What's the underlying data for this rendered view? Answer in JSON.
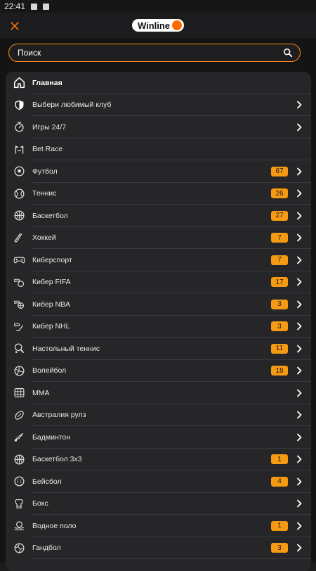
{
  "status": {
    "time": "22:41"
  },
  "header": {
    "logo_text": "Winline",
    "close_icon": "close-icon"
  },
  "search": {
    "placeholder": "Поиск",
    "icon": "search-icon"
  },
  "colors": {
    "accent": "#ff7a00",
    "badge": "#f59a12",
    "panel": "#262628",
    "background": "#141414"
  },
  "menu": {
    "items": [
      {
        "label": "Главная",
        "icon": "home-icon",
        "badge": null,
        "chevron": false
      },
      {
        "label": "Выбери любимый клуб",
        "icon": "shield-icon",
        "badge": null,
        "chevron": true
      },
      {
        "label": "Игры 24/7",
        "icon": "stopwatch-icon",
        "badge": null,
        "chevron": true
      },
      {
        "label": "Bet Race",
        "icon": "race-flags-icon",
        "badge": null,
        "chevron": false
      },
      {
        "label": "Футбол",
        "icon": "soccer-ball-icon",
        "badge": "67",
        "chevron": true
      },
      {
        "label": "Теннис",
        "icon": "tennis-ball-icon",
        "badge": "26",
        "chevron": true
      },
      {
        "label": "Баскетбол",
        "icon": "basketball-icon",
        "badge": "27",
        "chevron": true
      },
      {
        "label": "Хоккей",
        "icon": "hockey-stick-icon",
        "badge": "7",
        "chevron": true
      },
      {
        "label": "Киберспорт",
        "icon": "gamepad-icon",
        "badge": "7",
        "chevron": true
      },
      {
        "label": "Кибер FIFA",
        "icon": "cyber-fifa-icon",
        "badge": "17",
        "chevron": true
      },
      {
        "label": "Кибер NBA",
        "icon": "cyber-nba-icon",
        "badge": "3",
        "chevron": true
      },
      {
        "label": "Кибер NHL",
        "icon": "cyber-nhl-icon",
        "badge": "3",
        "chevron": true
      },
      {
        "label": "Настольный теннис",
        "icon": "table-tennis-icon",
        "badge": "11",
        "chevron": true
      },
      {
        "label": "Волейбол",
        "icon": "volleyball-icon",
        "badge": "18",
        "chevron": true
      },
      {
        "label": "MMA",
        "icon": "mma-cage-icon",
        "badge": null,
        "chevron": true
      },
      {
        "label": "Австралия рулз",
        "icon": "rugby-ball-icon",
        "badge": null,
        "chevron": true
      },
      {
        "label": "Бадминтон",
        "icon": "shuttlecock-icon",
        "badge": null,
        "chevron": true
      },
      {
        "label": "Баскетбол 3х3",
        "icon": "basketball-3x3-icon",
        "badge": "1",
        "chevron": true
      },
      {
        "label": "Бейсбол",
        "icon": "baseball-icon",
        "badge": "4",
        "chevron": true
      },
      {
        "label": "Бокс",
        "icon": "boxing-glove-icon",
        "badge": null,
        "chevron": true
      },
      {
        "label": "Водное поло",
        "icon": "water-polo-icon",
        "badge": "1",
        "chevron": true
      },
      {
        "label": "Гандбол",
        "icon": "handball-icon",
        "badge": "3",
        "chevron": true
      }
    ]
  }
}
